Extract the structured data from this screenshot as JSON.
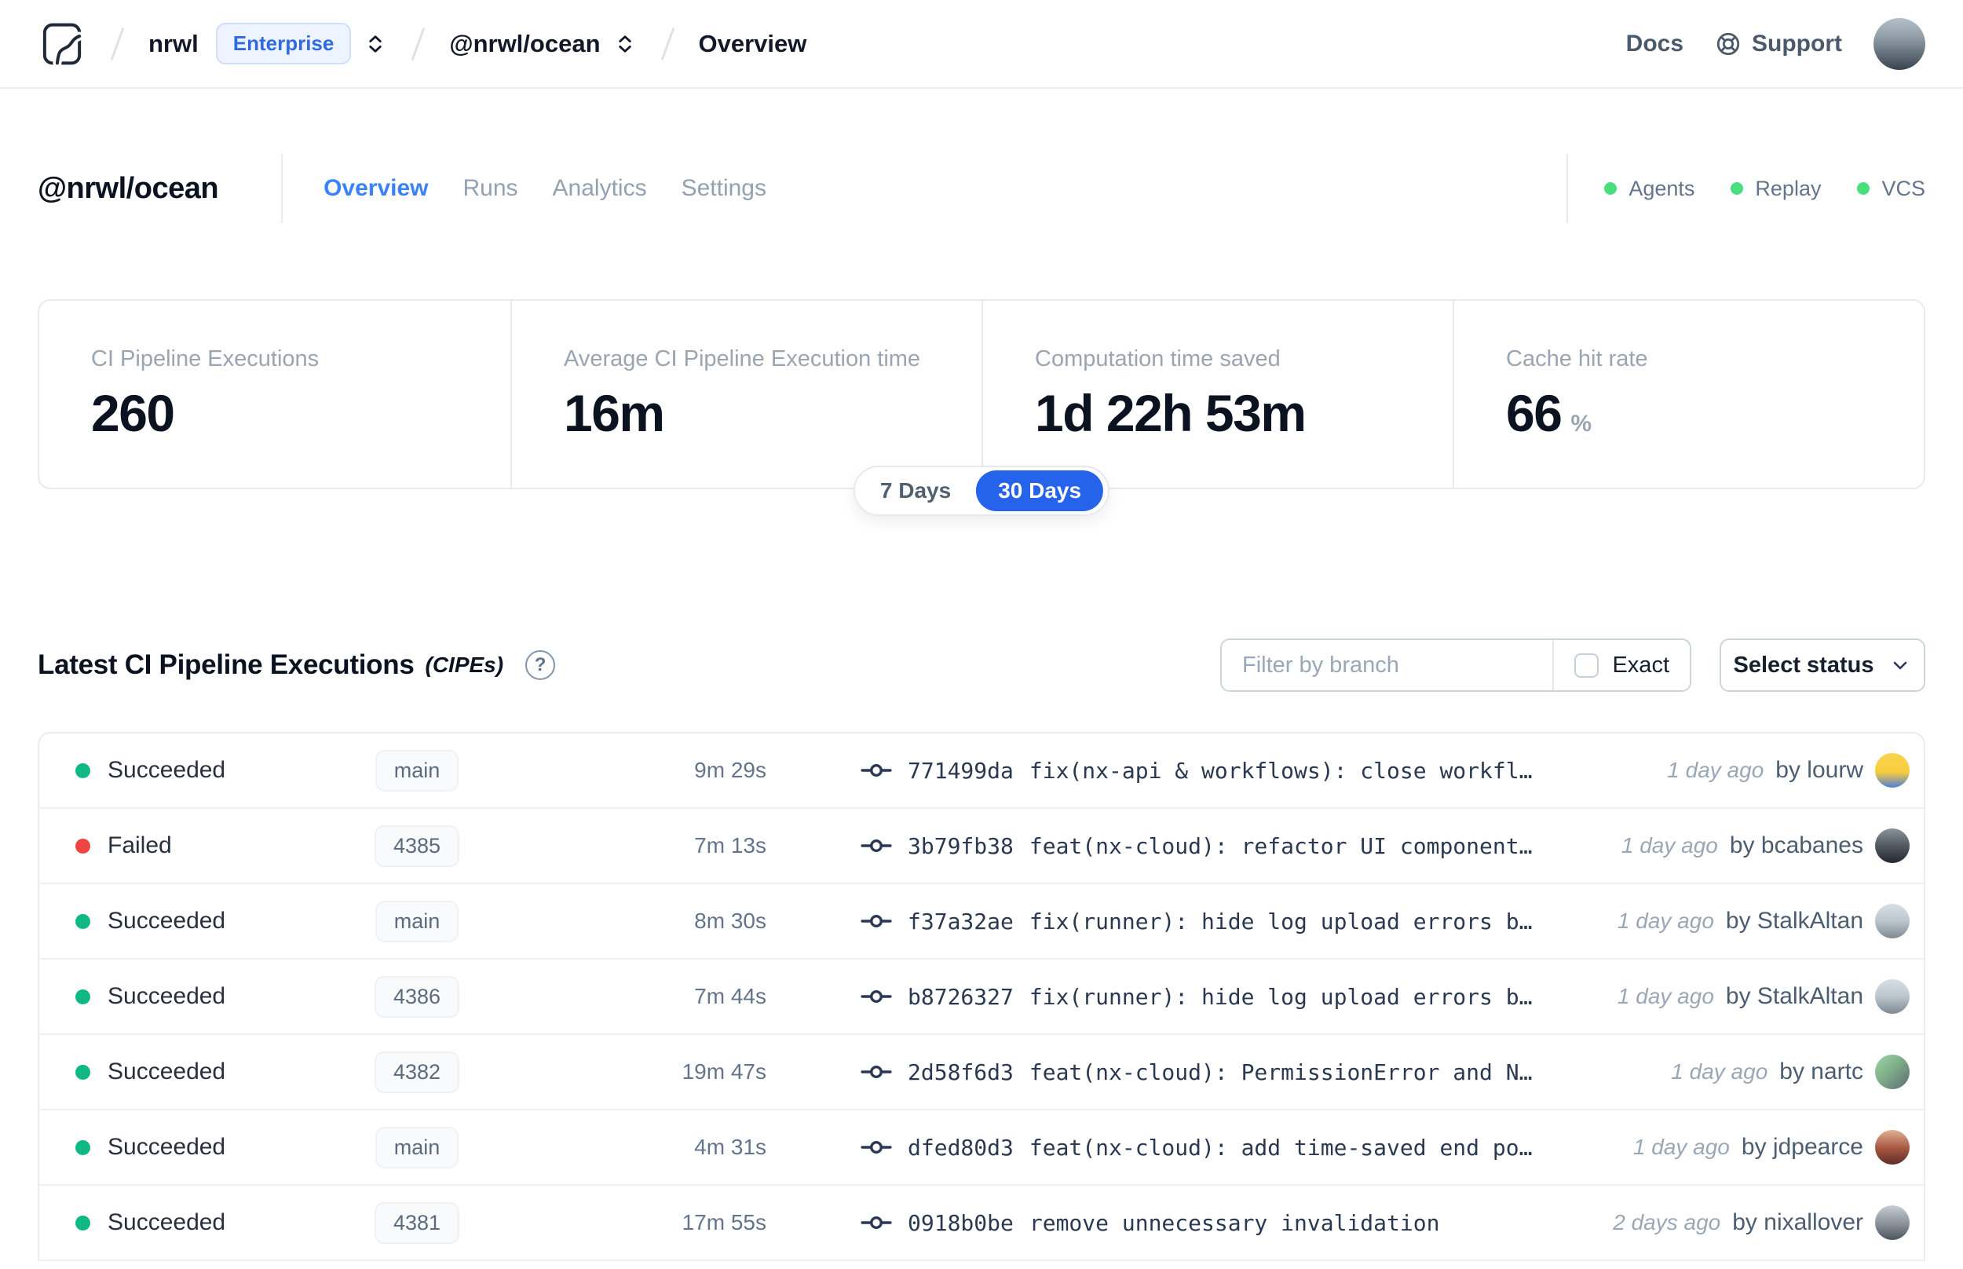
{
  "nav": {
    "org": "nrwl",
    "org_badge": "Enterprise",
    "workspace": "@nrwl/ocean",
    "page": "Overview",
    "docs": "Docs",
    "support": "Support"
  },
  "header": {
    "title": "@nrwl/ocean",
    "tabs": [
      {
        "label": "Overview",
        "active": true
      },
      {
        "label": "Runs",
        "active": false
      },
      {
        "label": "Analytics",
        "active": false
      },
      {
        "label": "Settings",
        "active": false
      }
    ],
    "integrations": [
      {
        "label": "Agents"
      },
      {
        "label": "Replay"
      },
      {
        "label": "VCS"
      }
    ]
  },
  "stats": {
    "cards": [
      {
        "label": "CI Pipeline Executions",
        "value": "260",
        "unit": ""
      },
      {
        "label": "Average CI Pipeline Execution time",
        "value": "16m",
        "unit": ""
      },
      {
        "label": "Computation time saved",
        "value": "1d 22h 53m",
        "unit": ""
      },
      {
        "label": "Cache hit rate",
        "value": "66",
        "unit": "%"
      }
    ],
    "range_toggle": {
      "options": [
        "7 Days",
        "30 Days"
      ],
      "selected": "30 Days"
    }
  },
  "cipes": {
    "title": "Latest CI Pipeline Executions",
    "title_suffix": "(CIPEs)",
    "filter_placeholder": "Filter by branch",
    "exact_label": "Exact",
    "status_dropdown_label": "Select status",
    "rows": [
      {
        "status": "Succeeded",
        "branch": "main",
        "duration": "9m 29s",
        "commit_hash": "771499da",
        "commit_message": "fix(nx-api & workflows): close workfl…",
        "time": "1 day ago",
        "author": "by lourw"
      },
      {
        "status": "Failed",
        "branch": "4385",
        "duration": "7m 13s",
        "commit_hash": "3b79fb38",
        "commit_message": "feat(nx-cloud): refactor UI component…",
        "time": "1 day ago",
        "author": "by bcabanes"
      },
      {
        "status": "Succeeded",
        "branch": "main",
        "duration": "8m 30s",
        "commit_hash": "f37a32ae",
        "commit_message": "fix(runner): hide log upload errors b…",
        "time": "1 day ago",
        "author": "by StalkAltan"
      },
      {
        "status": "Succeeded",
        "branch": "4386",
        "duration": "7m 44s",
        "commit_hash": "b8726327",
        "commit_message": "fix(runner): hide log upload errors b…",
        "time": "1 day ago",
        "author": "by StalkAltan"
      },
      {
        "status": "Succeeded",
        "branch": "4382",
        "duration": "19m 47s",
        "commit_hash": "2d58f6d3",
        "commit_message": "feat(nx-cloud): PermissionError and N…",
        "time": "1 day ago",
        "author": "by nartc"
      },
      {
        "status": "Succeeded",
        "branch": "main",
        "duration": "4m 31s",
        "commit_hash": "dfed80d3",
        "commit_message": "feat(nx-cloud): add time-saved end po…",
        "time": "1 day ago",
        "author": "by jdpearce"
      },
      {
        "status": "Succeeded",
        "branch": "4381",
        "duration": "17m 55s",
        "commit_hash": "0918b0be",
        "commit_message": "remove unnecessary invalidation",
        "time": "2 days ago",
        "author": "by nixallover"
      }
    ]
  },
  "colors": {
    "accent_blue": "#2563eb",
    "tab_active_blue": "#3b82f6",
    "success_green": "#10b981",
    "failed_red": "#ef4444",
    "integration_green": "#4ade80",
    "enterprise_badge_blue": "#2f6ae0"
  }
}
